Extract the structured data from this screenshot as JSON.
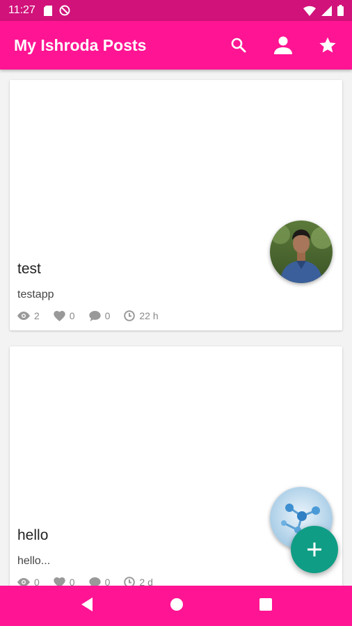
{
  "status_bar": {
    "time": "11:27",
    "left_icons": [
      "sd-card-icon",
      "no-disturb-icon"
    ],
    "right_icons": [
      "wifi-icon",
      "signal-icon",
      "battery-icon"
    ]
  },
  "app_bar": {
    "title": "My Ishroda Posts",
    "actions": [
      "search-icon",
      "person-icon",
      "star-icon"
    ],
    "color": "#ff1493"
  },
  "posts": [
    {
      "title": "test",
      "excerpt": "testapp",
      "views": "2",
      "likes": "0",
      "comments": "0",
      "age": "22 h",
      "avatar": "person-photo"
    },
    {
      "title": "hello",
      "excerpt": "hello...",
      "views": "0",
      "likes": "0",
      "comments": "0",
      "age": "2 d",
      "avatar": "molecule-image"
    }
  ],
  "fab": {
    "icon": "plus-icon",
    "color": "#0f9d85"
  },
  "nav_bar": {
    "icons": [
      "back-icon",
      "home-icon",
      "recents-icon"
    ]
  }
}
